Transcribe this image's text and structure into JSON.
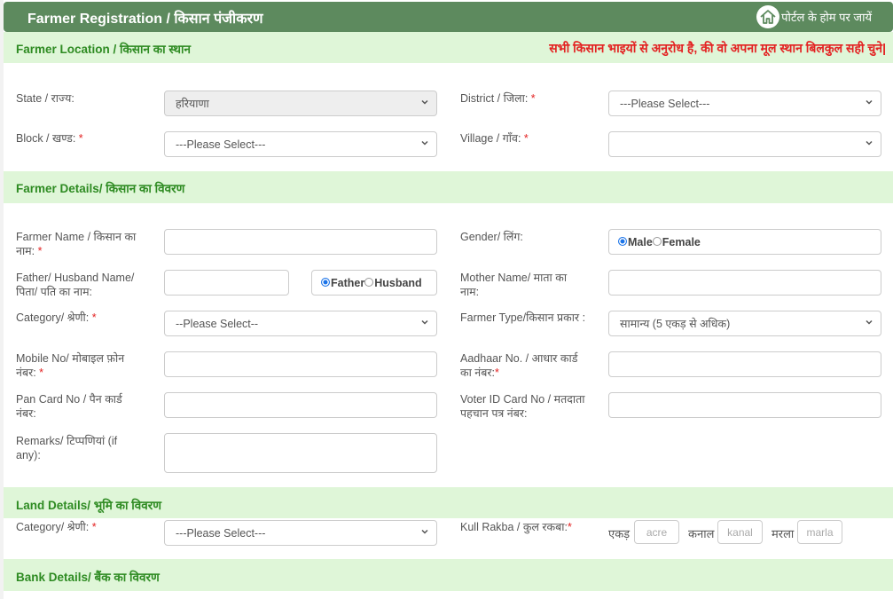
{
  "header": {
    "title": "Farmer Registration / किसान पंजीकरण",
    "home_link": "पोर्टल के होम पर जायें"
  },
  "sections": {
    "location": {
      "title": "Farmer Location / किसान का स्थान",
      "notice": "सभी किसान भाइयों से अनुरोध है, की वो अपना मूल स्थान बिलकुल सही चुने|"
    },
    "details": {
      "title": "Farmer Details/ किसान का विवरण"
    },
    "land": {
      "title": "Land Details/ भूमि का विवरण"
    },
    "bank": {
      "title": "Bank Details/ बैंक का विवरण"
    }
  },
  "location": {
    "state_label": "State / राज्य:",
    "state_value": "हरियाणा",
    "district_label": "District / जिला:",
    "district_value": "---Please Select---",
    "block_label": "Block / खण्ड:",
    "block_value": "---Please Select---",
    "village_label": "Village / गाँव:",
    "village_value": ""
  },
  "farmer": {
    "name_label_1": "Farmer Name / किसान का",
    "name_label_2": "नाम:",
    "name_value": "",
    "gender_label": "Gender/ लिंग:",
    "gender_options": [
      "Male",
      "Female"
    ],
    "gender_selected": "Male",
    "father_label_1": "Father/ Husband Name/",
    "father_label_2": "पिता/ पति का नाम:",
    "father_value": "",
    "relation_options": [
      "Father",
      "Husband"
    ],
    "relation_selected": "Father",
    "mother_label_1": "Mother Name/ माता का",
    "mother_label_2": "नाम:",
    "mother_value": "",
    "category_label": "Category/ श्रेणी:",
    "category_value": "--Please Select--",
    "farmer_type_label": "Farmer Type/किसान प्रकार :",
    "farmer_type_value": "सामान्य (5 एकड़ से अधिक)",
    "mobile_label_1": "Mobile No/ मोबाइल फ़ोन",
    "mobile_label_2": "नंबर:",
    "mobile_value": "",
    "aadhaar_label_1": "Aadhaar No. / आधार कार्ड",
    "aadhaar_label_2": "का नंबर:",
    "aadhaar_value": "",
    "pan_label_1": "Pan Card No / पैन कार्ड",
    "pan_label_2": "नंबर:",
    "pan_value": "",
    "voter_label_1": "Voter ID Card No / मतदाता",
    "voter_label_2": "पहचान पत्र नंबर:",
    "voter_value": "",
    "remarks_label_1": "Remarks/ टिप्पणियां (if",
    "remarks_label_2": "any):",
    "remarks_value": ""
  },
  "land": {
    "category_label": "Category/ श्रेणी:",
    "category_value": "---Please Select---",
    "rakba_label": "Kull Rakba / कुल रकबा:",
    "acre_label": "एकड़",
    "acre_placeholder": "acre",
    "kanal_label": "कनाल",
    "kanal_placeholder": "kanal",
    "marla_label": "मरला",
    "marla_placeholder": "marla"
  },
  "required_mark": "*",
  "colors": {
    "header_bg": "#5d8a5e",
    "section_bg": "#dff6d8",
    "section_text": "#2e8b22",
    "notice_text": "#e32222",
    "radio_selected": "#1a73e8"
  }
}
